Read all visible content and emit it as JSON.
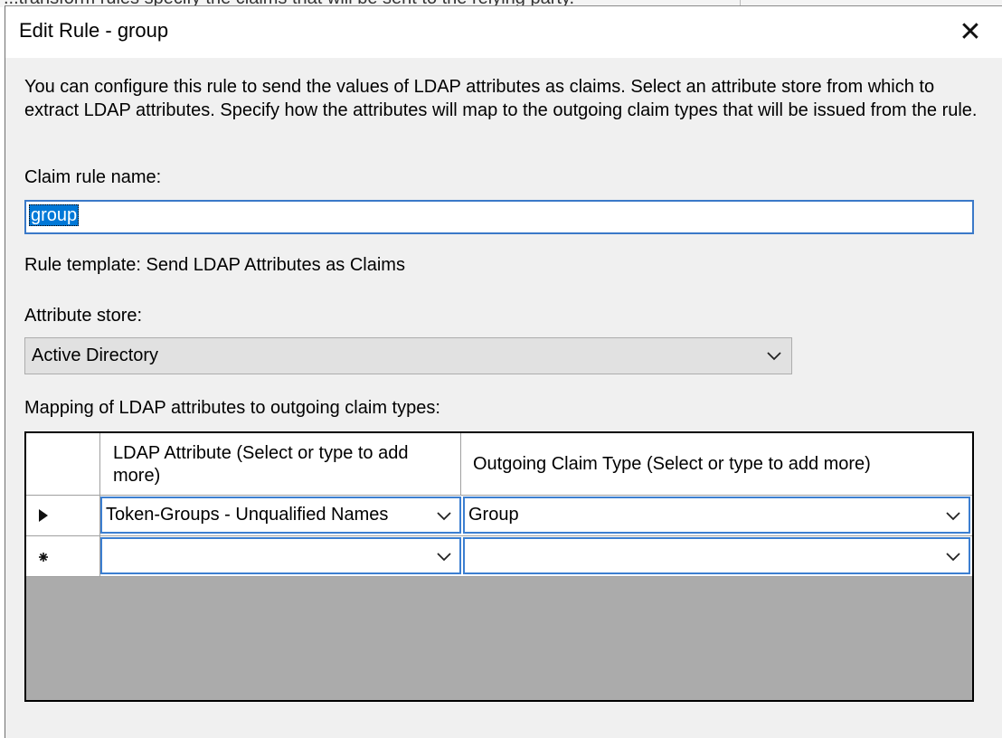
{
  "background": {
    "partial_text": "...transform rules specify the claims that will be sent to the relying party."
  },
  "dialog": {
    "title": "Edit Rule - group",
    "close_glyph": "✕",
    "description": "You can configure this rule to send the values of LDAP attributes as claims. Select an attribute store from which to extract LDAP attributes. Specify how the attributes will map to the outgoing claim types that will be issued from the rule.",
    "claim_rule_name_label": "Claim rule name:",
    "claim_rule_name_value": "group",
    "rule_template_text": "Rule template: Send LDAP Attributes as Claims",
    "attribute_store_label": "Attribute store:",
    "attribute_store_value": "Active Directory",
    "mapping_label": "Mapping of LDAP attributes to outgoing claim types:",
    "grid": {
      "columns": [
        "LDAP Attribute (Select or type to add more)",
        "Outgoing Claim Type (Select or type to add more)"
      ],
      "rows": [
        {
          "indicator": "▶",
          "ldap_attribute": "Token-Groups - Unqualified Names",
          "claim_type": "Group"
        },
        {
          "indicator": "*",
          "ldap_attribute": "",
          "claim_type": ""
        }
      ]
    }
  },
  "icons": {
    "dropdown": "chevron-down-icon",
    "close": "close-icon",
    "row_current": "row-arrow-icon",
    "row_new": "new-row-icon"
  }
}
